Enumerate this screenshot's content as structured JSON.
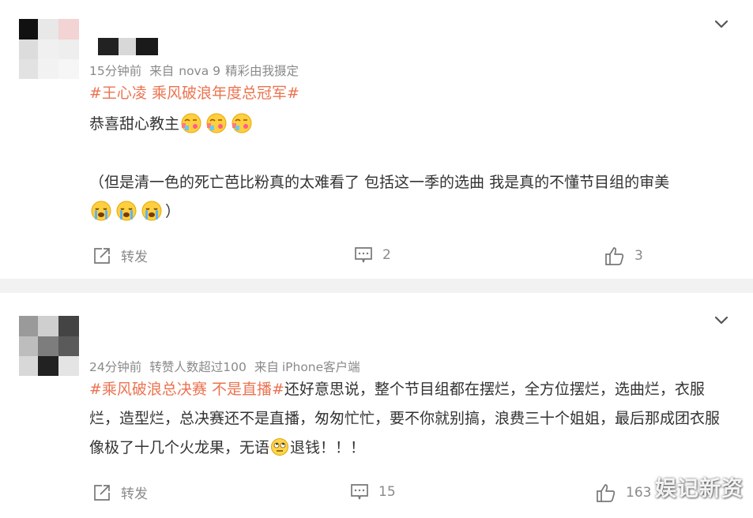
{
  "comments": [
    {
      "time": "15分钟前",
      "source_prefix": "来自",
      "device": "nova 9",
      "extra": "精彩由我摄定",
      "hashtag": "#王心凌 乘风破浪年度总冠军#",
      "line1": "恭喜甜心教主",
      "line2": "（但是清一色的死亡芭比粉真的太难看了 包括这一季的选曲 我是真的不懂节目组的审美",
      "line2_end": "）",
      "emoji1_name": "kiss-emoji",
      "emoji2_name": "crying-emoji",
      "repost_label": "转发",
      "comment_count": "2",
      "like_count": "3"
    },
    {
      "time": "24分钟前",
      "reposts_text": "转赞人数超过100",
      "source_prefix": "来自",
      "device": "iPhone客户端",
      "hashtag": "#乘风破浪总决赛 不是直播#",
      "body1": "还好意思说，整个节目组都在摆烂，全方位摆烂，选曲烂，衣服烂，造型烂，总决赛还不是直播，匆匆忙忙，要不你就别搞，浪费三十个姐姐，最后那成团衣服像极了十几个火龙果，无语",
      "body2": "退钱！！！",
      "emoji_name": "eye-roll-emoji",
      "repost_label": "转发",
      "comment_count": "15",
      "like_count": "163"
    }
  ],
  "watermark": "娱记新资",
  "colors": {
    "topic": "#eb7350",
    "meta": "#8a8a8a",
    "background": "#f2f2f2"
  }
}
